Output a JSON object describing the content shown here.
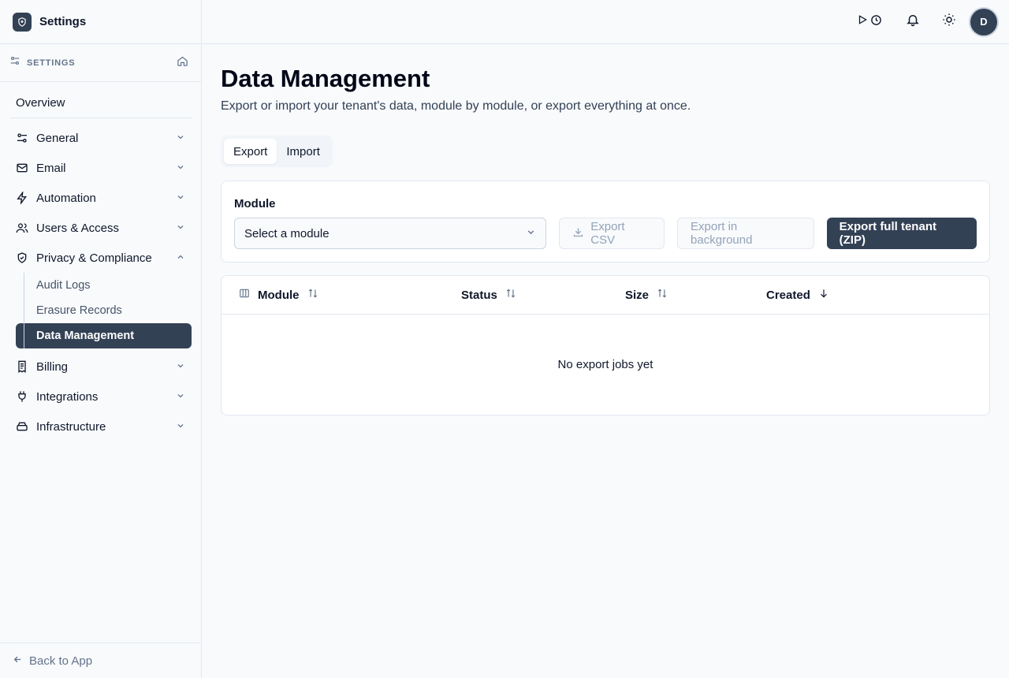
{
  "app": {
    "title": "Settings"
  },
  "sidebar": {
    "section_label": "SETTINGS",
    "overview": "Overview",
    "items": [
      {
        "label": "General",
        "icon": "sliders-icon"
      },
      {
        "label": "Email",
        "icon": "mail-icon"
      },
      {
        "label": "Automation",
        "icon": "bolt-icon"
      },
      {
        "label": "Users & Access",
        "icon": "users-icon"
      },
      {
        "label": "Privacy & Compliance",
        "icon": "shield-check-icon"
      },
      {
        "label": "Billing",
        "icon": "receipt-icon"
      },
      {
        "label": "Integrations",
        "icon": "plug-icon"
      },
      {
        "label": "Infrastructure",
        "icon": "server-icon"
      }
    ],
    "privacy_subitems": [
      "Audit Logs",
      "Erasure Records",
      "Data Management"
    ],
    "back": "Back to App"
  },
  "topbar": {
    "avatar_initial": "D"
  },
  "page": {
    "title": "Data Management",
    "subtitle": "Export or import your tenant's data, module by module, or export everything at once."
  },
  "tabs": [
    "Export",
    "Import"
  ],
  "export_card": {
    "module_label": "Module",
    "select_placeholder": "Select a module",
    "export_csv": "Export CSV",
    "export_background": "Export in background",
    "export_full": "Export full tenant (ZIP)"
  },
  "table": {
    "columns": [
      "Module",
      "Status",
      "Size",
      "Created"
    ],
    "empty": "No export jobs yet"
  },
  "colors": {
    "accent": "#334155",
    "border": "#e2e8f0",
    "muted": "#64748b"
  }
}
